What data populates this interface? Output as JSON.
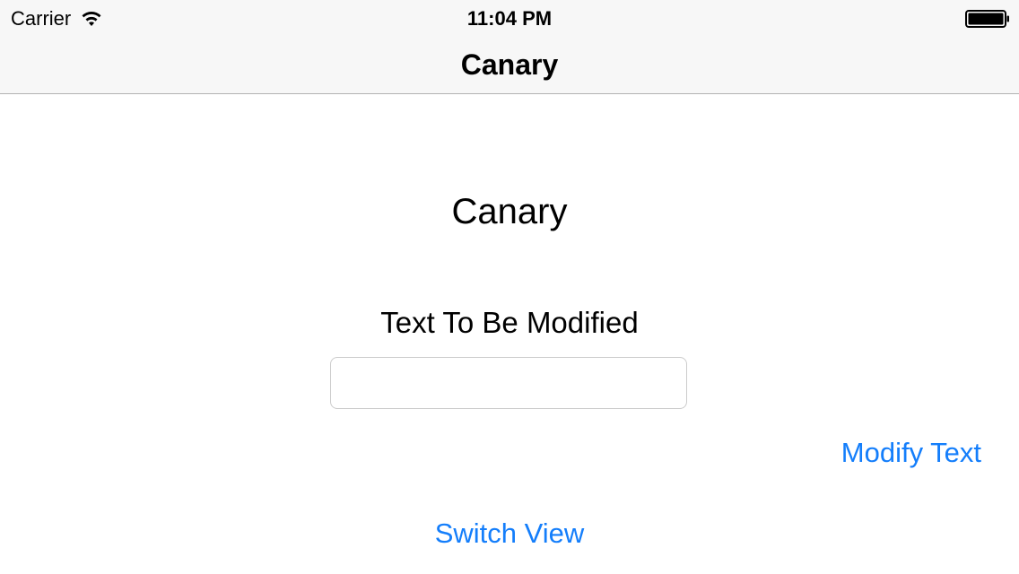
{
  "status_bar": {
    "carrier": "Carrier",
    "time": "11:04 PM",
    "wifi_icon": "wifi-icon",
    "battery_icon": "battery-icon",
    "battery_level": 1.0
  },
  "nav_bar": {
    "title": "Canary"
  },
  "content": {
    "title": "Canary",
    "field_label": "Text To Be Modified",
    "text_field": {
      "value": "",
      "placeholder": ""
    },
    "modify_button_label": "Modify Text",
    "switch_button_label": "Switch View"
  },
  "colors": {
    "accent": "#147efb",
    "bar_background": "#f7f7f7",
    "separator": "#b2b2b2"
  }
}
